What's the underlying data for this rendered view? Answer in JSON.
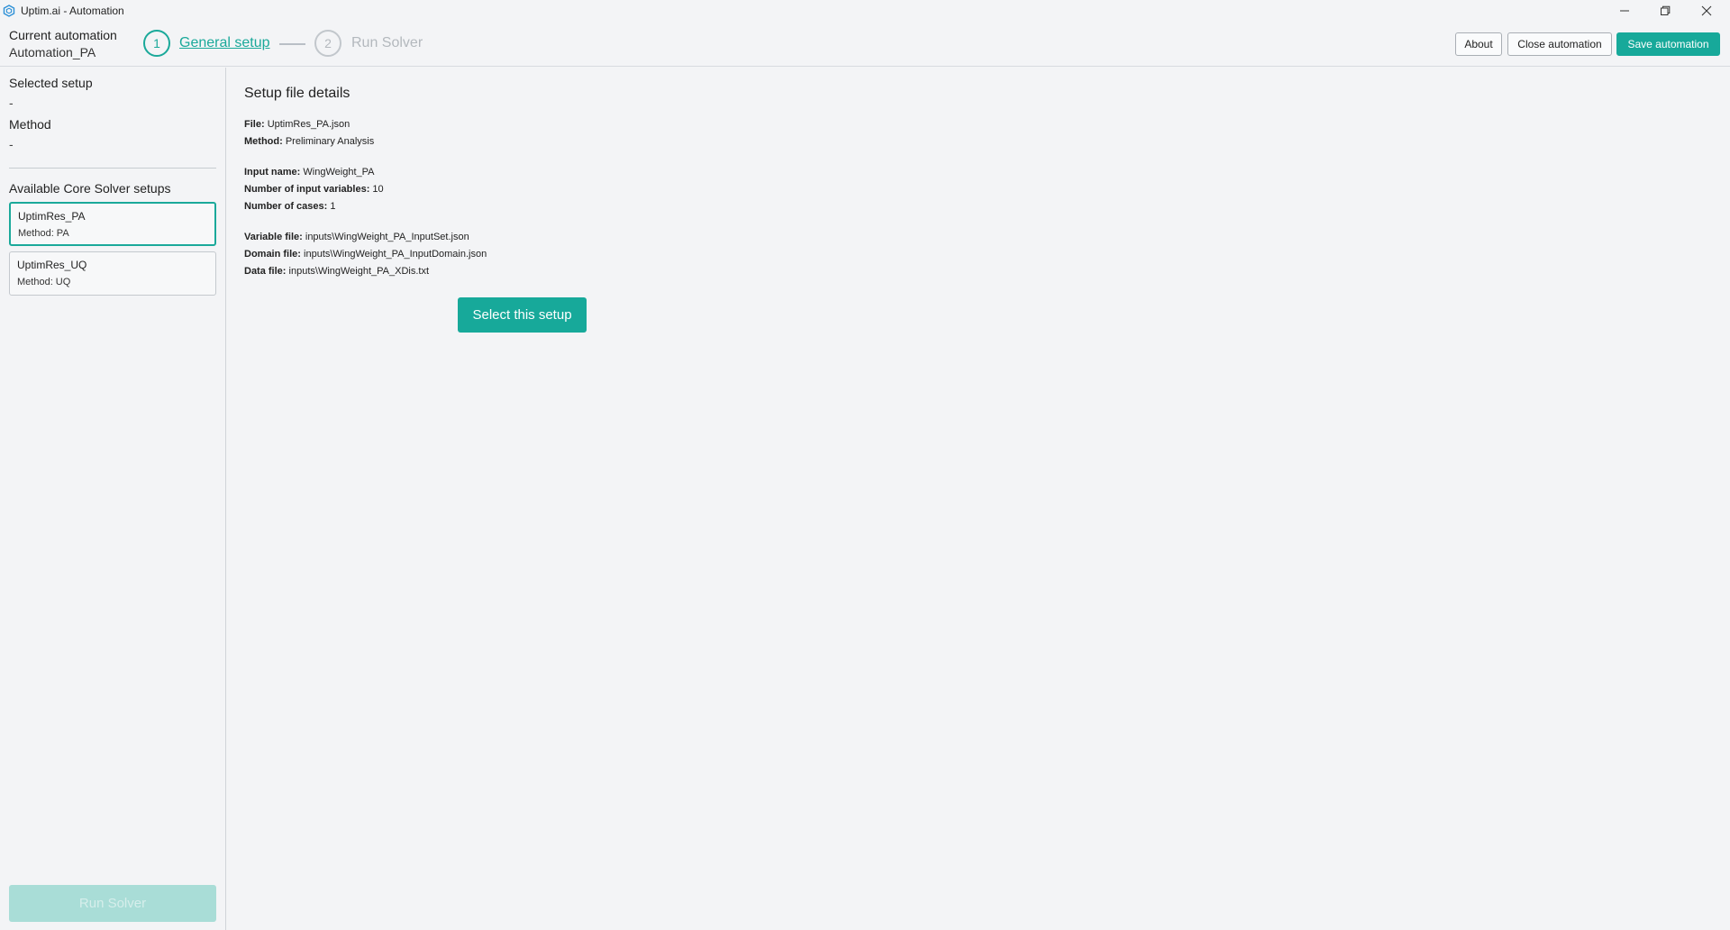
{
  "window": {
    "title": "Uptim.ai - Automation",
    "app_icon": "hexagon-logo-icon",
    "controls": {
      "minimize": "minimize-icon",
      "maximize": "restore-icon",
      "close": "close-icon"
    }
  },
  "header": {
    "current_label": "Current automation",
    "current_value": "Automation_PA",
    "steps": [
      {
        "number": "1",
        "label": "General setup",
        "active": true
      },
      {
        "number": "2",
        "label": "Run Solver",
        "active": false
      }
    ],
    "buttons": {
      "about": "About",
      "close_automation": "Close automation",
      "save_automation": "Save automation"
    }
  },
  "sidebar": {
    "selected_setup_label": "Selected setup",
    "selected_setup_value": "-",
    "method_label": "Method",
    "method_value": "-",
    "available_label": "Available Core Solver setups",
    "setups": [
      {
        "name": "UptimRes_PA",
        "method": "Method: PA",
        "selected": true
      },
      {
        "name": "UptimRes_UQ",
        "method": "Method: UQ",
        "selected": false
      }
    ],
    "run_solver_label": "Run Solver"
  },
  "main": {
    "title": "Setup file details",
    "details": {
      "file_label": "File:",
      "file_value": "UptimRes_PA.json",
      "method_label": "Method:",
      "method_value": "Preliminary Analysis",
      "input_name_label": "Input name:",
      "input_name_value": "WingWeight_PA",
      "num_vars_label": "Number of input variables:",
      "num_vars_value": "10",
      "num_cases_label": "Number of cases:",
      "num_cases_value": "1",
      "variable_file_label": "Variable file:",
      "variable_file_value": "inputs\\WingWeight_PA_InputSet.json",
      "domain_file_label": "Domain file:",
      "domain_file_value": "inputs\\WingWeight_PA_InputDomain.json",
      "data_file_label": "Data file:",
      "data_file_value": "inputs\\WingWeight_PA_XDis.txt"
    },
    "select_button": "Select this setup"
  },
  "colors": {
    "accent": "#17a99a",
    "background": "#f3f4f6",
    "disabled_accent": "#a9ddd7"
  }
}
